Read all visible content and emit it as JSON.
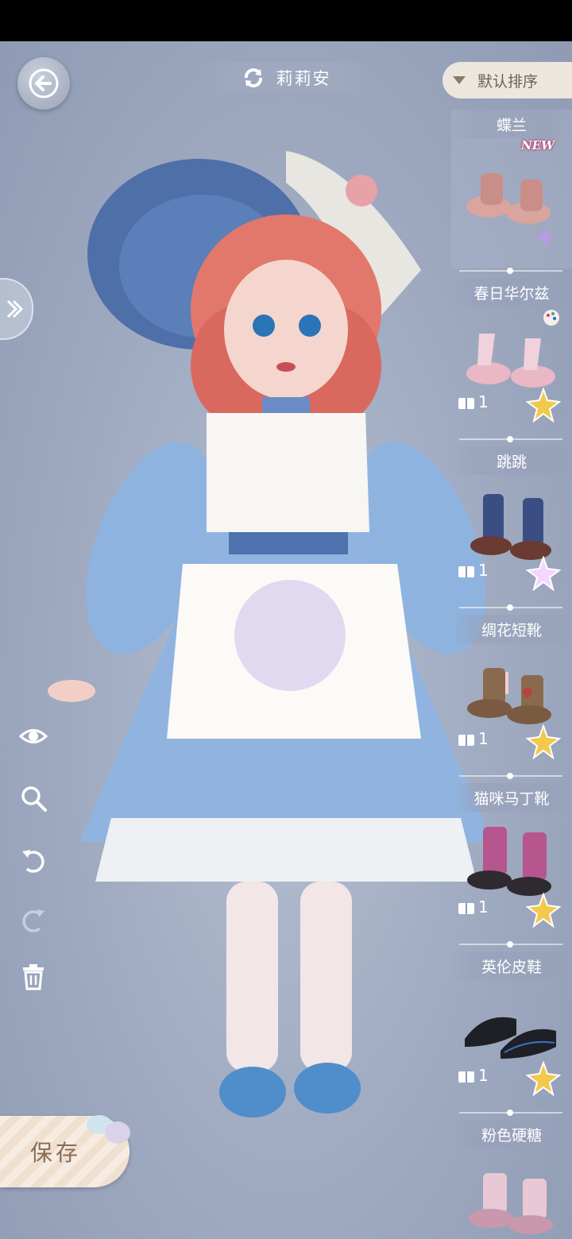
{
  "header": {
    "character_name": "莉莉安",
    "sort_label": "默认排序"
  },
  "save": {
    "label": "保存"
  },
  "items": [
    {
      "name": "蝶兰",
      "badge": "NEW",
      "count": ""
    },
    {
      "name": "春日华尔兹",
      "badge": "",
      "count": "1"
    },
    {
      "name": "跳跳",
      "badge": "",
      "count": "1"
    },
    {
      "name": "绸花短靴",
      "badge": "",
      "count": "1"
    },
    {
      "name": "猫咪马丁靴",
      "badge": "",
      "count": "1"
    },
    {
      "name": "英伦皮鞋",
      "badge": "",
      "count": "1"
    },
    {
      "name": "粉色硬糖",
      "badge": "",
      "count": ""
    }
  ],
  "colors": {
    "accent": "#e9e2d9",
    "panel": "#a2adc3",
    "save_text": "#8a6c55"
  },
  "icons": [
    "back-arrow-icon",
    "switch-icon",
    "triangle-down-icon",
    "expand-icon",
    "eye-icon",
    "zoom-icon",
    "undo-icon",
    "redo-icon",
    "trash-icon",
    "gift-icon",
    "star-icon",
    "palette-icon"
  ]
}
